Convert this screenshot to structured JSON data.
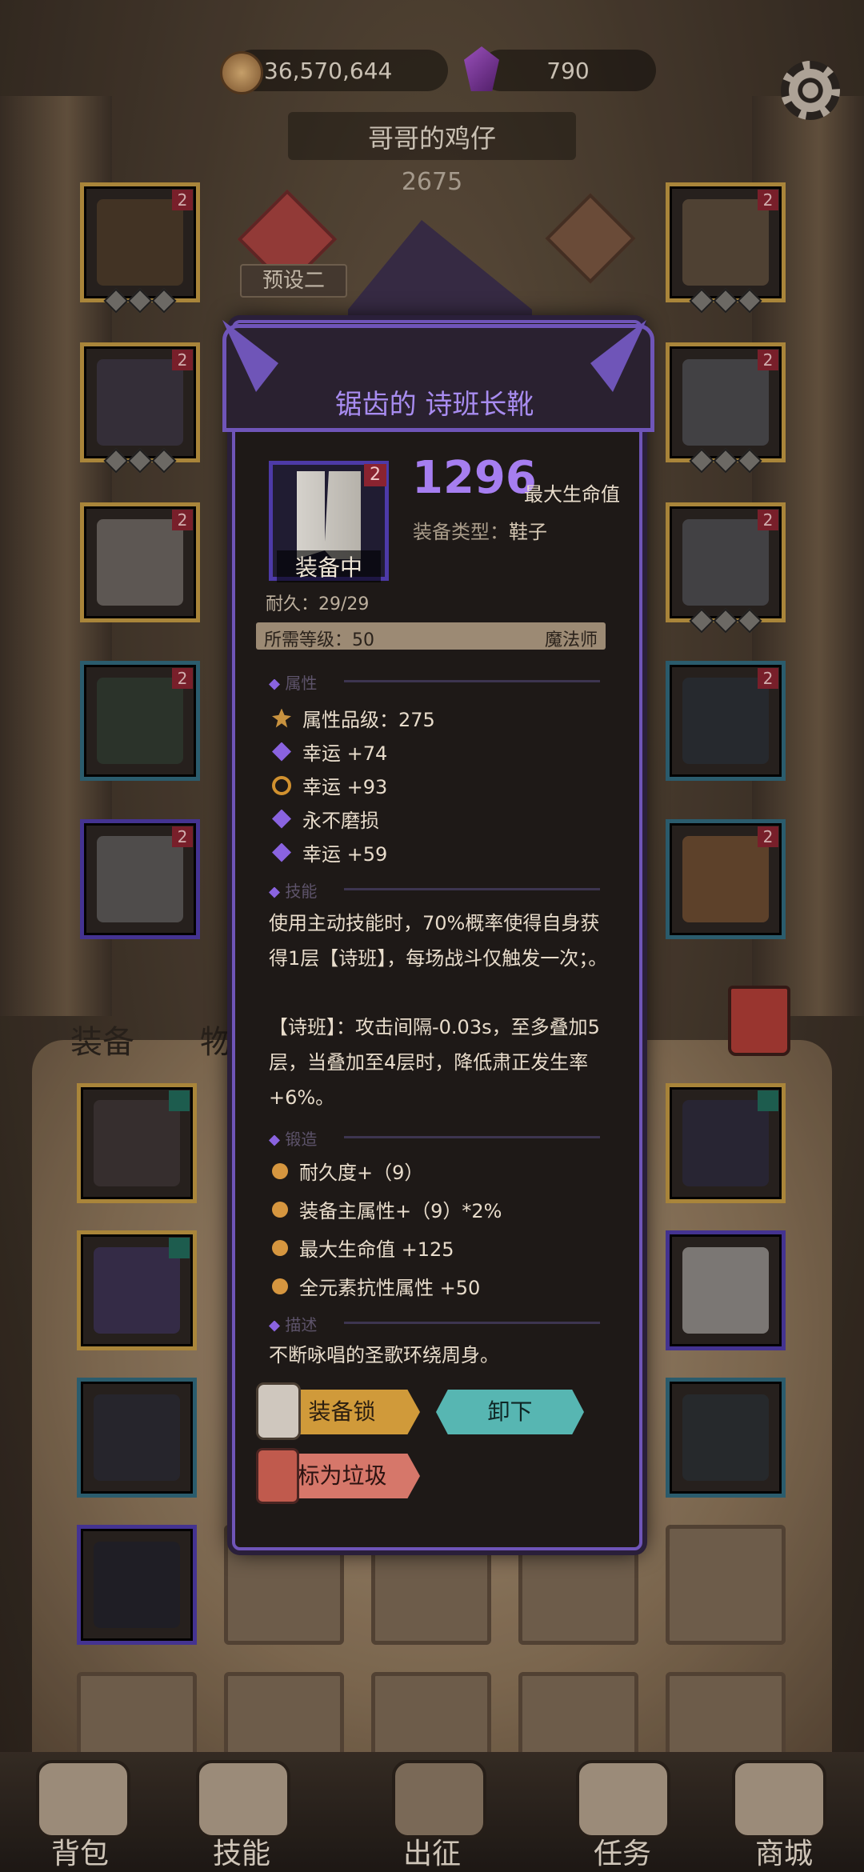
{
  "currency": {
    "gold": "36,570,644",
    "gems": "790"
  },
  "character": {
    "name": "哥哥的鸡仔",
    "power": "2675",
    "preset": "预设二"
  },
  "item": {
    "title": "锯齿的 诗班长靴",
    "level": "2",
    "status": "装备中",
    "main_value": "1296",
    "main_stat": "最大生命值",
    "type_label": "装备类型：",
    "type_value": "鞋子",
    "durability": "耐久：29/29",
    "req_level": "所需等级：50",
    "req_class": "魔法师",
    "section_attr": "属性",
    "attributes": [
      "属性品级：275",
      "幸运 +74",
      "幸运 +93",
      "永不磨损",
      "幸运 +59"
    ],
    "section_skill": "技能",
    "skill_text_1": "使用主动技能时，70%概率使得自身获得1层【诗班】，每场战斗仅触发一次；。",
    "skill_text_2": "【诗班】：攻击间隔-0.03s，至多叠加5层，当叠加至4层时，降低肃正发生率+6%。",
    "section_forge": "锻造",
    "forge": [
      "耐久度+（9）",
      "装备主属性+（9）*2%",
      "最大生命值 +125",
      "全元素抗性属性 +50"
    ],
    "section_desc": "描述",
    "description": "不断咏唱的圣歌环绕周身。",
    "buttons": {
      "lock": "装备锁",
      "unequip": "卸下",
      "junk": "标为垃圾"
    }
  },
  "slots": {
    "level_badge": "2"
  },
  "tabs": {
    "equipment": "装备",
    "items": "物品"
  },
  "nav": [
    "背包",
    "技能",
    "出征",
    "任务",
    "商城"
  ],
  "colors": {
    "accent_purple": "#6f55b8",
    "item_value": "#a67ef0",
    "unequip": "#57b6b2",
    "lock": "#d09a3a",
    "junk": "#d6776a"
  }
}
